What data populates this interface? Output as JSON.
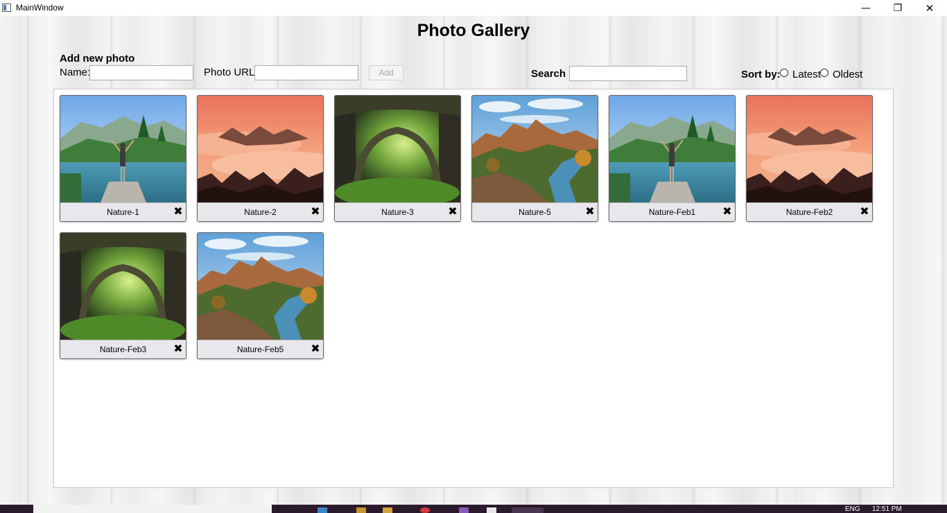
{
  "window": {
    "title": "MainWindow",
    "minimize_icon": "—",
    "maximize_icon": "❐",
    "close_icon": "✕"
  },
  "header": {
    "title": "Photo Gallery"
  },
  "add_form": {
    "heading": "Add new photo",
    "name_label": "Name:",
    "name_value": "",
    "url_label": "Photo URL:",
    "url_value": "",
    "add_label": "Add"
  },
  "search": {
    "label": "Search :",
    "value": ""
  },
  "sort": {
    "label": "Sort by:",
    "options": [
      "Latest",
      "Oldest"
    ],
    "selected": null
  },
  "photos": [
    {
      "name": "Nature-1",
      "image": "lake-dock"
    },
    {
      "name": "Nature-2",
      "image": "orange-mist"
    },
    {
      "name": "Nature-3",
      "image": "forest-tunnel"
    },
    {
      "name": "Nature-5",
      "image": "canyon-river"
    },
    {
      "name": "Nature-Feb1",
      "image": "lake-dock"
    },
    {
      "name": "Nature-Feb2",
      "image": "orange-mist"
    },
    {
      "name": "Nature-Feb3",
      "image": "forest-tunnel"
    },
    {
      "name": "Nature-Feb5",
      "image": "canyon-river"
    }
  ],
  "delete_icon": "✖",
  "taskbar": {
    "lang": "ENG",
    "time": "12:51 PM"
  }
}
